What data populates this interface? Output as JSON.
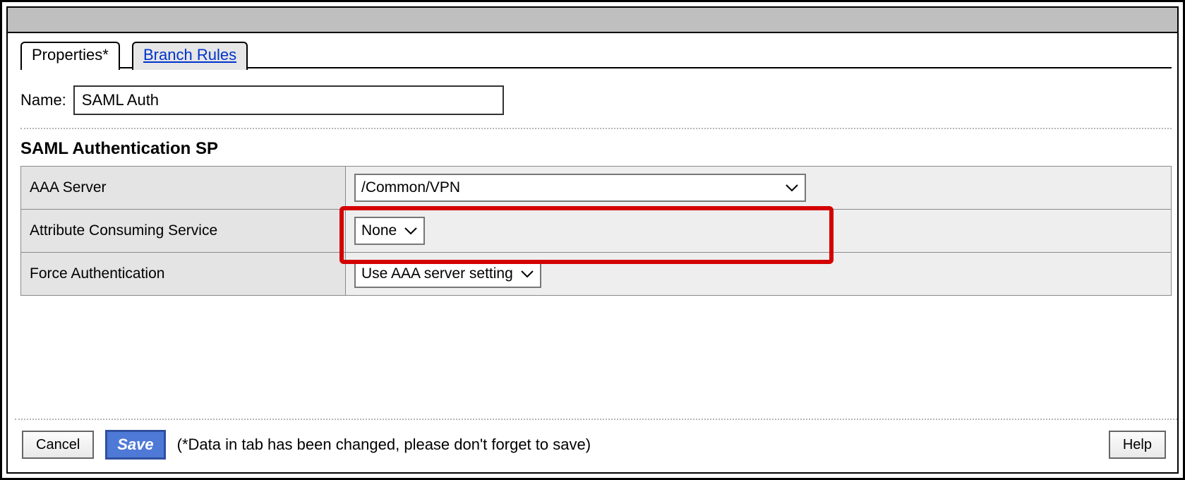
{
  "tabs": {
    "active_label": "Properties*",
    "inactive_label": "Branch Rules"
  },
  "form": {
    "name_label": "Name:",
    "name_value": "SAML Auth",
    "section_title": "SAML Authentication SP",
    "rows": {
      "aaa_server": {
        "label": "AAA Server",
        "value": "/Common/VPN"
      },
      "attr_consuming": {
        "label": "Attribute Consuming Service",
        "value": "None"
      },
      "force_auth": {
        "label": "Force Authentication",
        "value": "Use AAA server setting"
      }
    }
  },
  "footer": {
    "cancel": "Cancel",
    "save": "Save",
    "note": "(*Data in tab has been changed, please don't forget to save)",
    "help": "Help"
  }
}
